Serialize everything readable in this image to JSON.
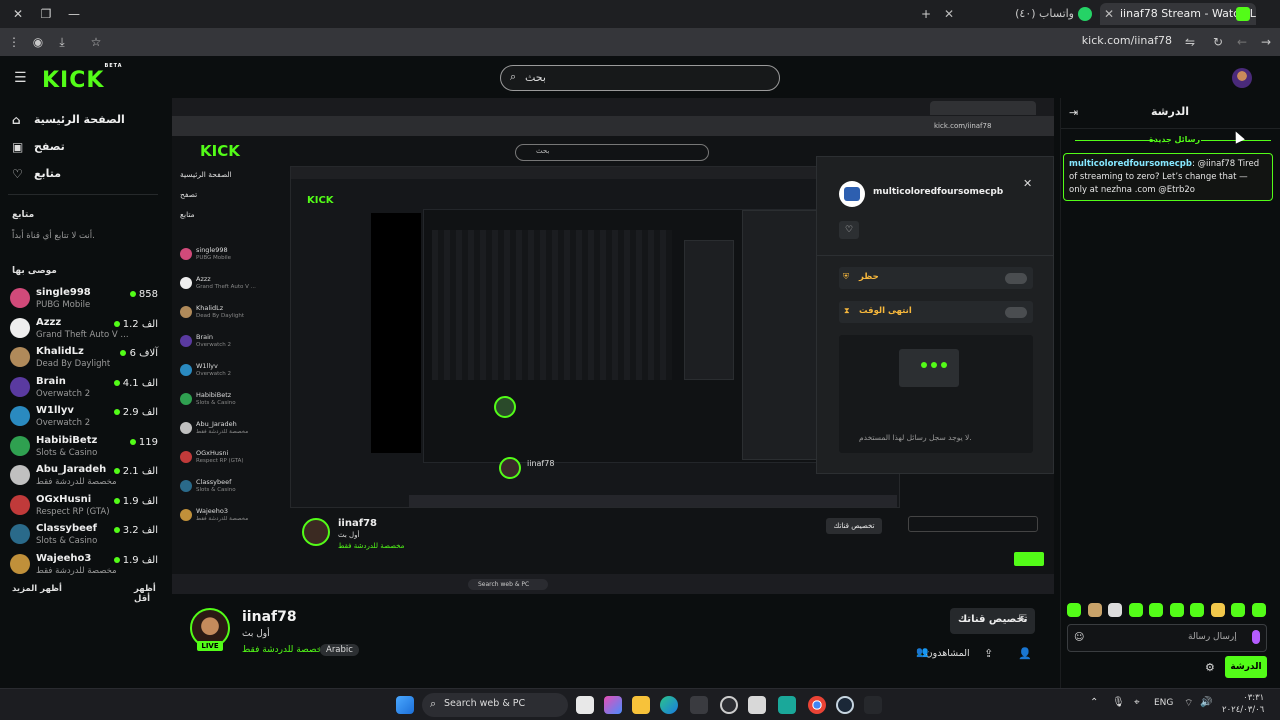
{
  "browser": {
    "tabs": [
      {
        "title": "iinaf78 Stream - Watch Live on",
        "active": true
      },
      {
        "title": "(٤٠) واتساب",
        "active": false
      }
    ],
    "url": "kick.com/iinaf78"
  },
  "header": {
    "logo": "KICK",
    "logo_badge": "BETA",
    "search_placeholder": "بحث"
  },
  "sidebar": {
    "nav": [
      {
        "label": "الصفحة الرئيسية",
        "icon": "home-icon"
      },
      {
        "label": "تصفح",
        "icon": "browse-icon"
      },
      {
        "label": "متابع",
        "icon": "heart-icon"
      }
    ],
    "following_title": "متابع",
    "following_empty": "أنت لا تتابع أي قناة أبداً.",
    "recommended_title": "موصى بها",
    "channels": [
      {
        "name": "single998",
        "game": "PUBG Mobile",
        "viewers": "858",
        "color": "#d14a7a"
      },
      {
        "name": "Azzz",
        "game": "Grand Theft Auto V ...",
        "viewers": "الف 1.2",
        "color": "#eeeeee"
      },
      {
        "name": "KhalidLz",
        "game": "Dead By Daylight",
        "viewers": "آلاف 6",
        "color": "#b08a5a"
      },
      {
        "name": "Brain",
        "game": "Overwatch 2",
        "viewers": "الف 4.1",
        "color": "#5a3aa0"
      },
      {
        "name": "W1llyv",
        "game": "Overwatch 2",
        "viewers": "الف 2.9",
        "color": "#2a8ac0"
      },
      {
        "name": "HabibiBetz",
        "game": "Slots & Casino",
        "viewers": "119",
        "color": "#2fa050"
      },
      {
        "name": "Abu_Jaradeh",
        "game": "مخصصة للدردشة فقط",
        "viewers": "الف 2.1",
        "color": "#c0c0c0"
      },
      {
        "name": "OGxHusni",
        "game": "Respect RP (GTA)",
        "viewers": "الف 1.9",
        "color": "#c03a3a"
      },
      {
        "name": "Classybeef",
        "game": "Slots & Casino",
        "viewers": "الف 3.2",
        "color": "#2a6a8a"
      },
      {
        "name": "Wajeeho3",
        "game": "مخصصة للدردشة فقط",
        "viewers": "الف 1.9",
        "color": "#c0903a"
      }
    ],
    "show_more": "أظهر المزيد",
    "show_less": "أظهر أقل"
  },
  "stream": {
    "channel": "iinaf78",
    "subtitle": "أول بث",
    "live_badge": "LIVE",
    "category": "مخصصة للدردشة فقط",
    "language": "Arabic",
    "customize_button": "تخصيص قناتك",
    "viewers_label": "المشاهدون",
    "viewers_count": "1"
  },
  "chat": {
    "title": "الدرشة",
    "new_messages": "رسائل جديدة",
    "messages": [
      {
        "user": "multicoloredfoursomecpb",
        "text": ": @iinaf78 Tired of streaming to zero? Let’s change that — only at nezhna .com @Etrb2o"
      }
    ],
    "input_placeholder": "إرسال رسالة",
    "send_button": "الدرشة"
  },
  "user_card": {
    "username": "multicoloredfoursomecpb",
    "ban_label": "حظر",
    "timeout_label": "انتهى الوقت",
    "empty_history": "لا يوجد سجل رسائل لهذا المستخدم."
  },
  "taskbar": {
    "search": "Search web & PC",
    "lang": "ENG",
    "time": "٠٣:٣١",
    "date": "٢٠٢٤/٠٣/٠٦"
  },
  "colors": {
    "accent": "#53fc18",
    "background": "#0b0e0f",
    "panel": "#1b1d1f"
  }
}
